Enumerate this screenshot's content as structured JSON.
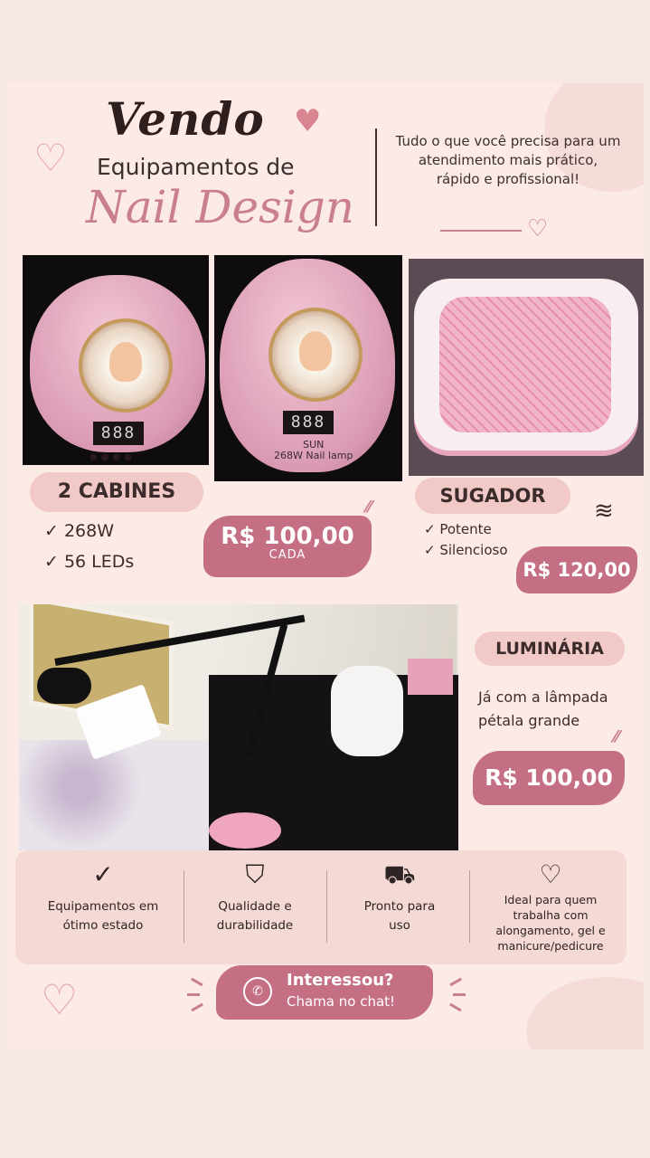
{
  "header": {
    "vendo": "Vendo",
    "equipamentos": "Equipamentos de",
    "nail_design": "Nail Design",
    "tagline": "Tudo o que você precisa para um atendimento mais prático, rápido e profissional!"
  },
  "cabines": {
    "title": "2 CABINES",
    "features": [
      "✓ 268W",
      "✓ 56 LEDs"
    ],
    "price": "R$ 100,00",
    "price_note": "CADA",
    "display_text": "888",
    "label_sun": "SUN",
    "label_model": "268W Nail lamp"
  },
  "sugador": {
    "title": "SUGADOR",
    "features": [
      "✓ Potente",
      "✓ Silencioso"
    ],
    "price": "R$ 120,00"
  },
  "luminaria": {
    "title": "LUMINÁRIA",
    "description": "Já com a lâmpada pétala grande",
    "price": "R$ 100,00"
  },
  "benefits": [
    {
      "icon": "check-circle-icon",
      "text": "Equipamentos em ótimo estado"
    },
    {
      "icon": "shield-check-icon",
      "text": "Qualidade e durabilidade"
    },
    {
      "icon": "delivery-truck-icon",
      "text": "Pronto para uso"
    },
    {
      "icon": "heart-icon",
      "text": "Ideal para quem trabalha com alongamento, gel e manicure/pedicure"
    }
  ],
  "cta": {
    "line1": "Interessou?",
    "line2": "Chama no chat!"
  },
  "colors": {
    "background": "#fbeae6",
    "accent_pink": "#c56f85",
    "pill_pink": "#f1c9c6",
    "text_dark": "#3b2b2b"
  }
}
